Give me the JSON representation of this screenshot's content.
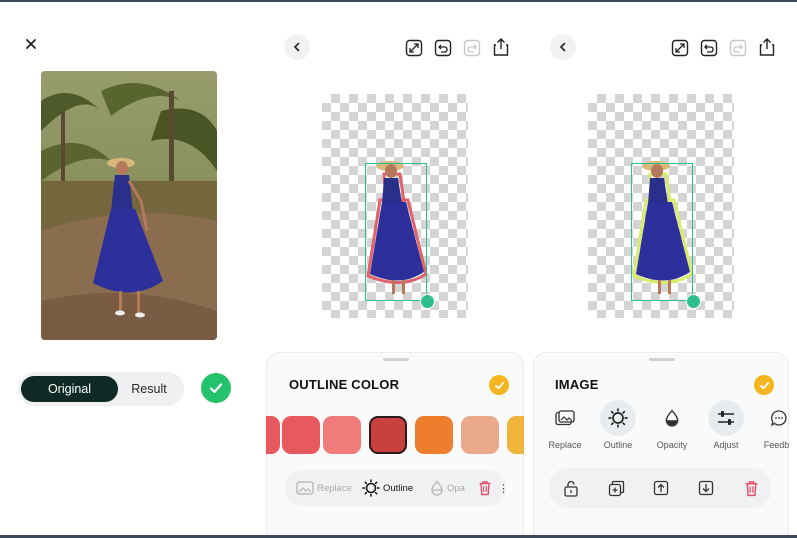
{
  "left_panel": {
    "toggle": {
      "original_label": "Original",
      "result_label": "Result",
      "selected": "Original"
    }
  },
  "outline_panel": {
    "sheet_title": "OUTLINE COLOR",
    "swatches": [
      {
        "color": "#e8585f"
      },
      {
        "color": "#ef7b7b"
      },
      {
        "color": "#c9413e",
        "selected": true
      },
      {
        "color": "#ee7d2e"
      },
      {
        "color": "#eaa98a"
      },
      {
        "color": "#f1b43a"
      }
    ],
    "toolbar": {
      "replace_label": "Replace",
      "outline_label": "Outline",
      "opacity_label": "Opa"
    }
  },
  "image_panel": {
    "sheet_title": "IMAGE",
    "tools": [
      {
        "label": "Replace",
        "icon": "image-icon"
      },
      {
        "label": "Outline",
        "icon": "outline-icon",
        "highlighted": true
      },
      {
        "label": "Opacity",
        "icon": "drop-icon"
      },
      {
        "label": "Adjust",
        "icon": "sliders-icon",
        "highlighted": true
      },
      {
        "label": "Feedba",
        "icon": "chat-icon"
      }
    ],
    "bottom_icons": [
      "unlock-icon",
      "duplicate-icon",
      "bring-forward-icon",
      "send-backward-icon",
      "trash-icon"
    ]
  },
  "colors": {
    "accent_green": "#23c26b",
    "selection_green": "#2fbf8f",
    "check_yellow": "#f4b51f",
    "toggle_dark": "#0f2a24",
    "delete_red": "#e4506b"
  }
}
